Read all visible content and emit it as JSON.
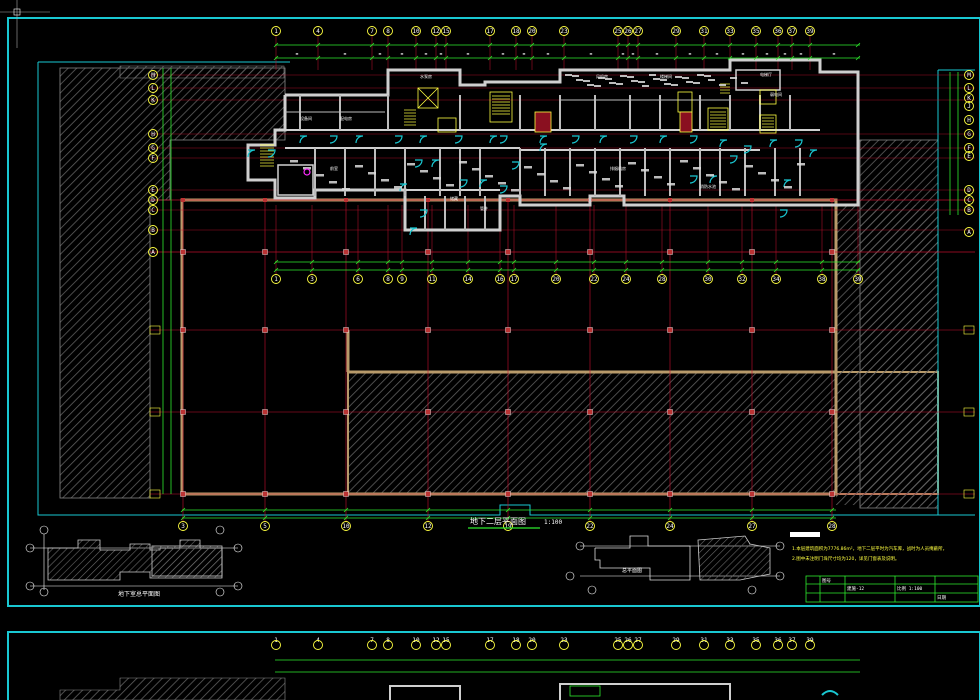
{
  "colors": {
    "background": "#000000",
    "frame": "#19c8d2",
    "wall": "#cfcfcf",
    "wall_fill": "#3a3a3a",
    "grid_axis": "#c8102e",
    "dimension": "#2eea2e",
    "hatch": "#6a6a6a",
    "door": "#19c8d2",
    "bubble": "#ffff40",
    "stair": "#ffff40",
    "text": "#ffffff",
    "accent_magenta": "#ff2cff"
  },
  "drawing": {
    "top_axis_labels": [
      "1",
      "4",
      "7",
      "8",
      "10",
      "12",
      "15",
      "17",
      "18",
      "20",
      "23",
      "25",
      "26",
      "27",
      "29",
      "31",
      "33",
      "35",
      "36",
      "37",
      "39"
    ],
    "mid_axis_labels": [
      "1",
      "3",
      "6",
      "8",
      "9",
      "11",
      "14",
      "16",
      "17",
      "20",
      "22",
      "24",
      "28",
      "30",
      "32",
      "34",
      "38",
      "39"
    ],
    "bottom_axis_labels": [
      "3",
      "5",
      "10",
      "12",
      "19",
      "22",
      "24",
      "27",
      "28"
    ],
    "left_axis_labels": [
      "M",
      "L",
      "K",
      "H",
      "G",
      "F",
      "E",
      "D",
      "C",
      "B",
      "A"
    ],
    "right_axis_labels": [
      "M",
      "L",
      "K",
      "J",
      "H",
      "G",
      "F",
      "E",
      "D",
      "C",
      "B",
      "A"
    ],
    "main_title": "地下二层平面图",
    "scale": "1:100",
    "key_plan_title": "地下室总平面图",
    "site_plan_label": "总平面图"
  },
  "notes": {
    "line1": "1.本层建筑面积为7776.86m²，地下二层平时为汽车库，战时为人员掩蔽所，",
    "line2": "2.图中未注明门垛尺寸均为120，详见门窗表及说明。"
  },
  "title_block": {
    "col1": "图号",
    "col2": "建施-12",
    "col3": "比例 1:100",
    "col4": "日期"
  },
  "room_labels": [
    "设备间",
    "配电房",
    "水泵房",
    "风机房",
    "楼梯间",
    "电梯厅",
    "前室",
    "储藏",
    "管井",
    "排烟机房",
    "消防水池",
    "弱电间"
  ]
}
